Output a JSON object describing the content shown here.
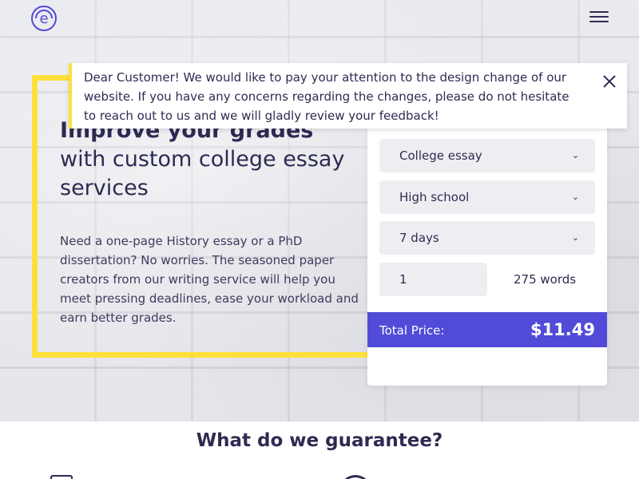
{
  "header": {
    "logo_letter": "e",
    "menu_icon": "hamburger-icon"
  },
  "notice": {
    "text": "Dear Customer! We would like to pay your attention to the design change of our website. If you have any concerns regarding the changes, please do not hesitate to reach out to us and we will gladly review your feedback!",
    "close_icon": "close-icon"
  },
  "hero": {
    "title_bold": "Improve your grades",
    "title_rest": " with custom college essay services",
    "description": "Need a one-page History essay or a PhD dissertation? No worries. The seasoned paper creators from our writing service will help you meet pressing deadlines, ease your workload and earn better grades."
  },
  "calculator": {
    "paper_type": "College essay",
    "academic_level": "High school",
    "deadline": "7 days",
    "pages": "1",
    "words": "275 words",
    "total_label": "Total Price:",
    "total_price": "$11.49",
    "chevron_icon": "chevron-down-icon"
  },
  "guarantees": {
    "title": "What do we guarantee?"
  },
  "colors": {
    "accent": "#514bd8",
    "highlight": "#fde03a",
    "text": "#2e2b52"
  }
}
